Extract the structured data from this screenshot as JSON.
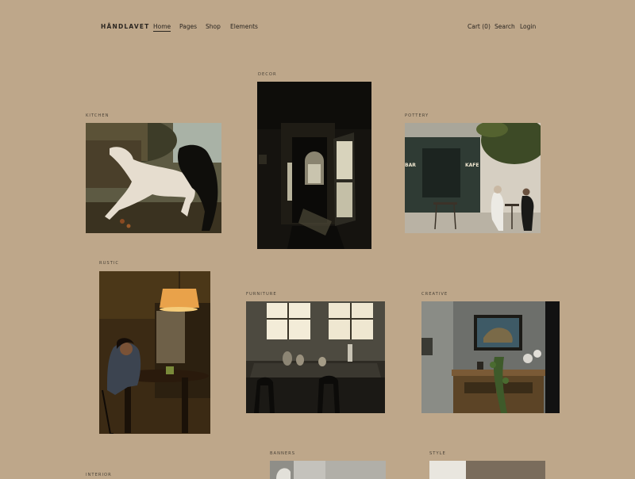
{
  "header": {
    "brand": "HÅNDLAVET",
    "nav": [
      "Home",
      "Pages",
      "Shop",
      "Elements"
    ],
    "cart": "Cart (0)",
    "search": "Search",
    "login": "Login"
  },
  "categories": {
    "decor": "DECOR",
    "kitchen": "KITCHEN",
    "pottery": "POTTERY",
    "rustic": "RUSTIC",
    "furniture": "FURNITURE",
    "creative": "CREATIVE",
    "banners": "BANNERS",
    "style": "STYLE",
    "interior": "INTERIOR"
  },
  "sign": {
    "bar": "BAR",
    "kafe": "KAFE"
  }
}
